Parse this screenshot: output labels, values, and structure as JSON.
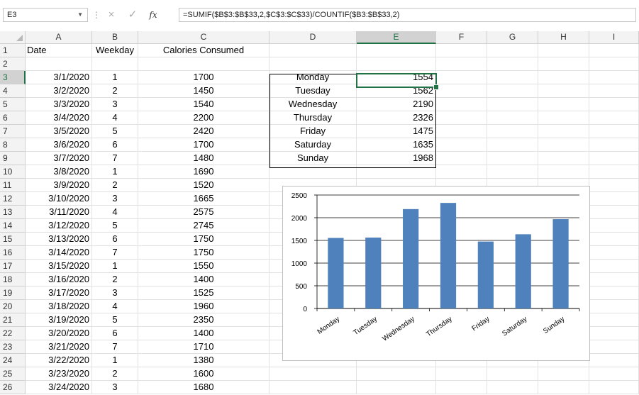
{
  "formula_bar": {
    "name_box": "E3",
    "fx_label": "fx",
    "formula": "=SUMIF($B$3:$B$33,2,$C$3:$C$33)/COUNTIF($B3:$B$33,2)",
    "cancel_glyph": "×",
    "enter_glyph": "✓"
  },
  "columns": [
    "A",
    "B",
    "C",
    "D",
    "E",
    "F",
    "G",
    "H",
    "I"
  ],
  "rows": [
    {
      "n": "1",
      "a": "Date",
      "b": "Weekday",
      "c": "Calories Consumed",
      "d": "",
      "e": ""
    },
    {
      "n": "2",
      "a": "",
      "b": "",
      "c": "",
      "d": "",
      "e": ""
    },
    {
      "n": "3",
      "a": "3/1/2020",
      "b": "1",
      "c": "1700",
      "d": "Monday",
      "e": "1554"
    },
    {
      "n": "4",
      "a": "3/2/2020",
      "b": "2",
      "c": "1450",
      "d": "Tuesday",
      "e": "1562"
    },
    {
      "n": "5",
      "a": "3/3/2020",
      "b": "3",
      "c": "1540",
      "d": "Wednesday",
      "e": "2190"
    },
    {
      "n": "6",
      "a": "3/4/2020",
      "b": "4",
      "c": "2200",
      "d": "Thursday",
      "e": "2326"
    },
    {
      "n": "7",
      "a": "3/5/2020",
      "b": "5",
      "c": "2420",
      "d": "Friday",
      "e": "1475"
    },
    {
      "n": "8",
      "a": "3/6/2020",
      "b": "6",
      "c": "1700",
      "d": "Saturday",
      "e": "1635"
    },
    {
      "n": "9",
      "a": "3/7/2020",
      "b": "7",
      "c": "1480",
      "d": "Sunday",
      "e": "1968"
    },
    {
      "n": "10",
      "a": "3/8/2020",
      "b": "1",
      "c": "1690",
      "d": "",
      "e": ""
    },
    {
      "n": "11",
      "a": "3/9/2020",
      "b": "2",
      "c": "1520",
      "d": "",
      "e": ""
    },
    {
      "n": "12",
      "a": "3/10/2020",
      "b": "3",
      "c": "1665",
      "d": "",
      "e": ""
    },
    {
      "n": "13",
      "a": "3/11/2020",
      "b": "4",
      "c": "2575",
      "d": "",
      "e": ""
    },
    {
      "n": "14",
      "a": "3/12/2020",
      "b": "5",
      "c": "2745",
      "d": "",
      "e": ""
    },
    {
      "n": "15",
      "a": "3/13/2020",
      "b": "6",
      "c": "1750",
      "d": "",
      "e": ""
    },
    {
      "n": "16",
      "a": "3/14/2020",
      "b": "7",
      "c": "1750",
      "d": "",
      "e": ""
    },
    {
      "n": "17",
      "a": "3/15/2020",
      "b": "1",
      "c": "1550",
      "d": "",
      "e": ""
    },
    {
      "n": "18",
      "a": "3/16/2020",
      "b": "2",
      "c": "1400",
      "d": "",
      "e": ""
    },
    {
      "n": "19",
      "a": "3/17/2020",
      "b": "3",
      "c": "1525",
      "d": "",
      "e": ""
    },
    {
      "n": "20",
      "a": "3/18/2020",
      "b": "4",
      "c": "1960",
      "d": "",
      "e": ""
    },
    {
      "n": "21",
      "a": "3/19/2020",
      "b": "5",
      "c": "2350",
      "d": "",
      "e": ""
    },
    {
      "n": "22",
      "a": "3/20/2020",
      "b": "6",
      "c": "1400",
      "d": "",
      "e": ""
    },
    {
      "n": "23",
      "a": "3/21/2020",
      "b": "7",
      "c": "1710",
      "d": "",
      "e": ""
    },
    {
      "n": "24",
      "a": "3/22/2020",
      "b": "1",
      "c": "1380",
      "d": "",
      "e": ""
    },
    {
      "n": "25",
      "a": "3/23/2020",
      "b": "2",
      "c": "1600",
      "d": "",
      "e": ""
    },
    {
      "n": "26",
      "a": "3/24/2020",
      "b": "3",
      "c": "1680",
      "d": "",
      "e": ""
    }
  ],
  "selected": {
    "column": "E",
    "row": "3"
  },
  "chart_data": {
    "type": "bar",
    "categories": [
      "Monday",
      "Tuesday",
      "Wednesday",
      "Thursday",
      "Friday",
      "Saturday",
      "Sunday"
    ],
    "values": [
      1554,
      1562,
      2190,
      2326,
      1475,
      1635,
      1968
    ],
    "title": "",
    "xlabel": "",
    "ylabel": "",
    "ylim": [
      0,
      2500
    ],
    "yticks": [
      "0",
      "500",
      "1000",
      "1500",
      "2000",
      "2500"
    ],
    "bar_color": "#4f81bd",
    "grid": true,
    "legend": "none"
  },
  "colors": {
    "accent": "#217346"
  }
}
